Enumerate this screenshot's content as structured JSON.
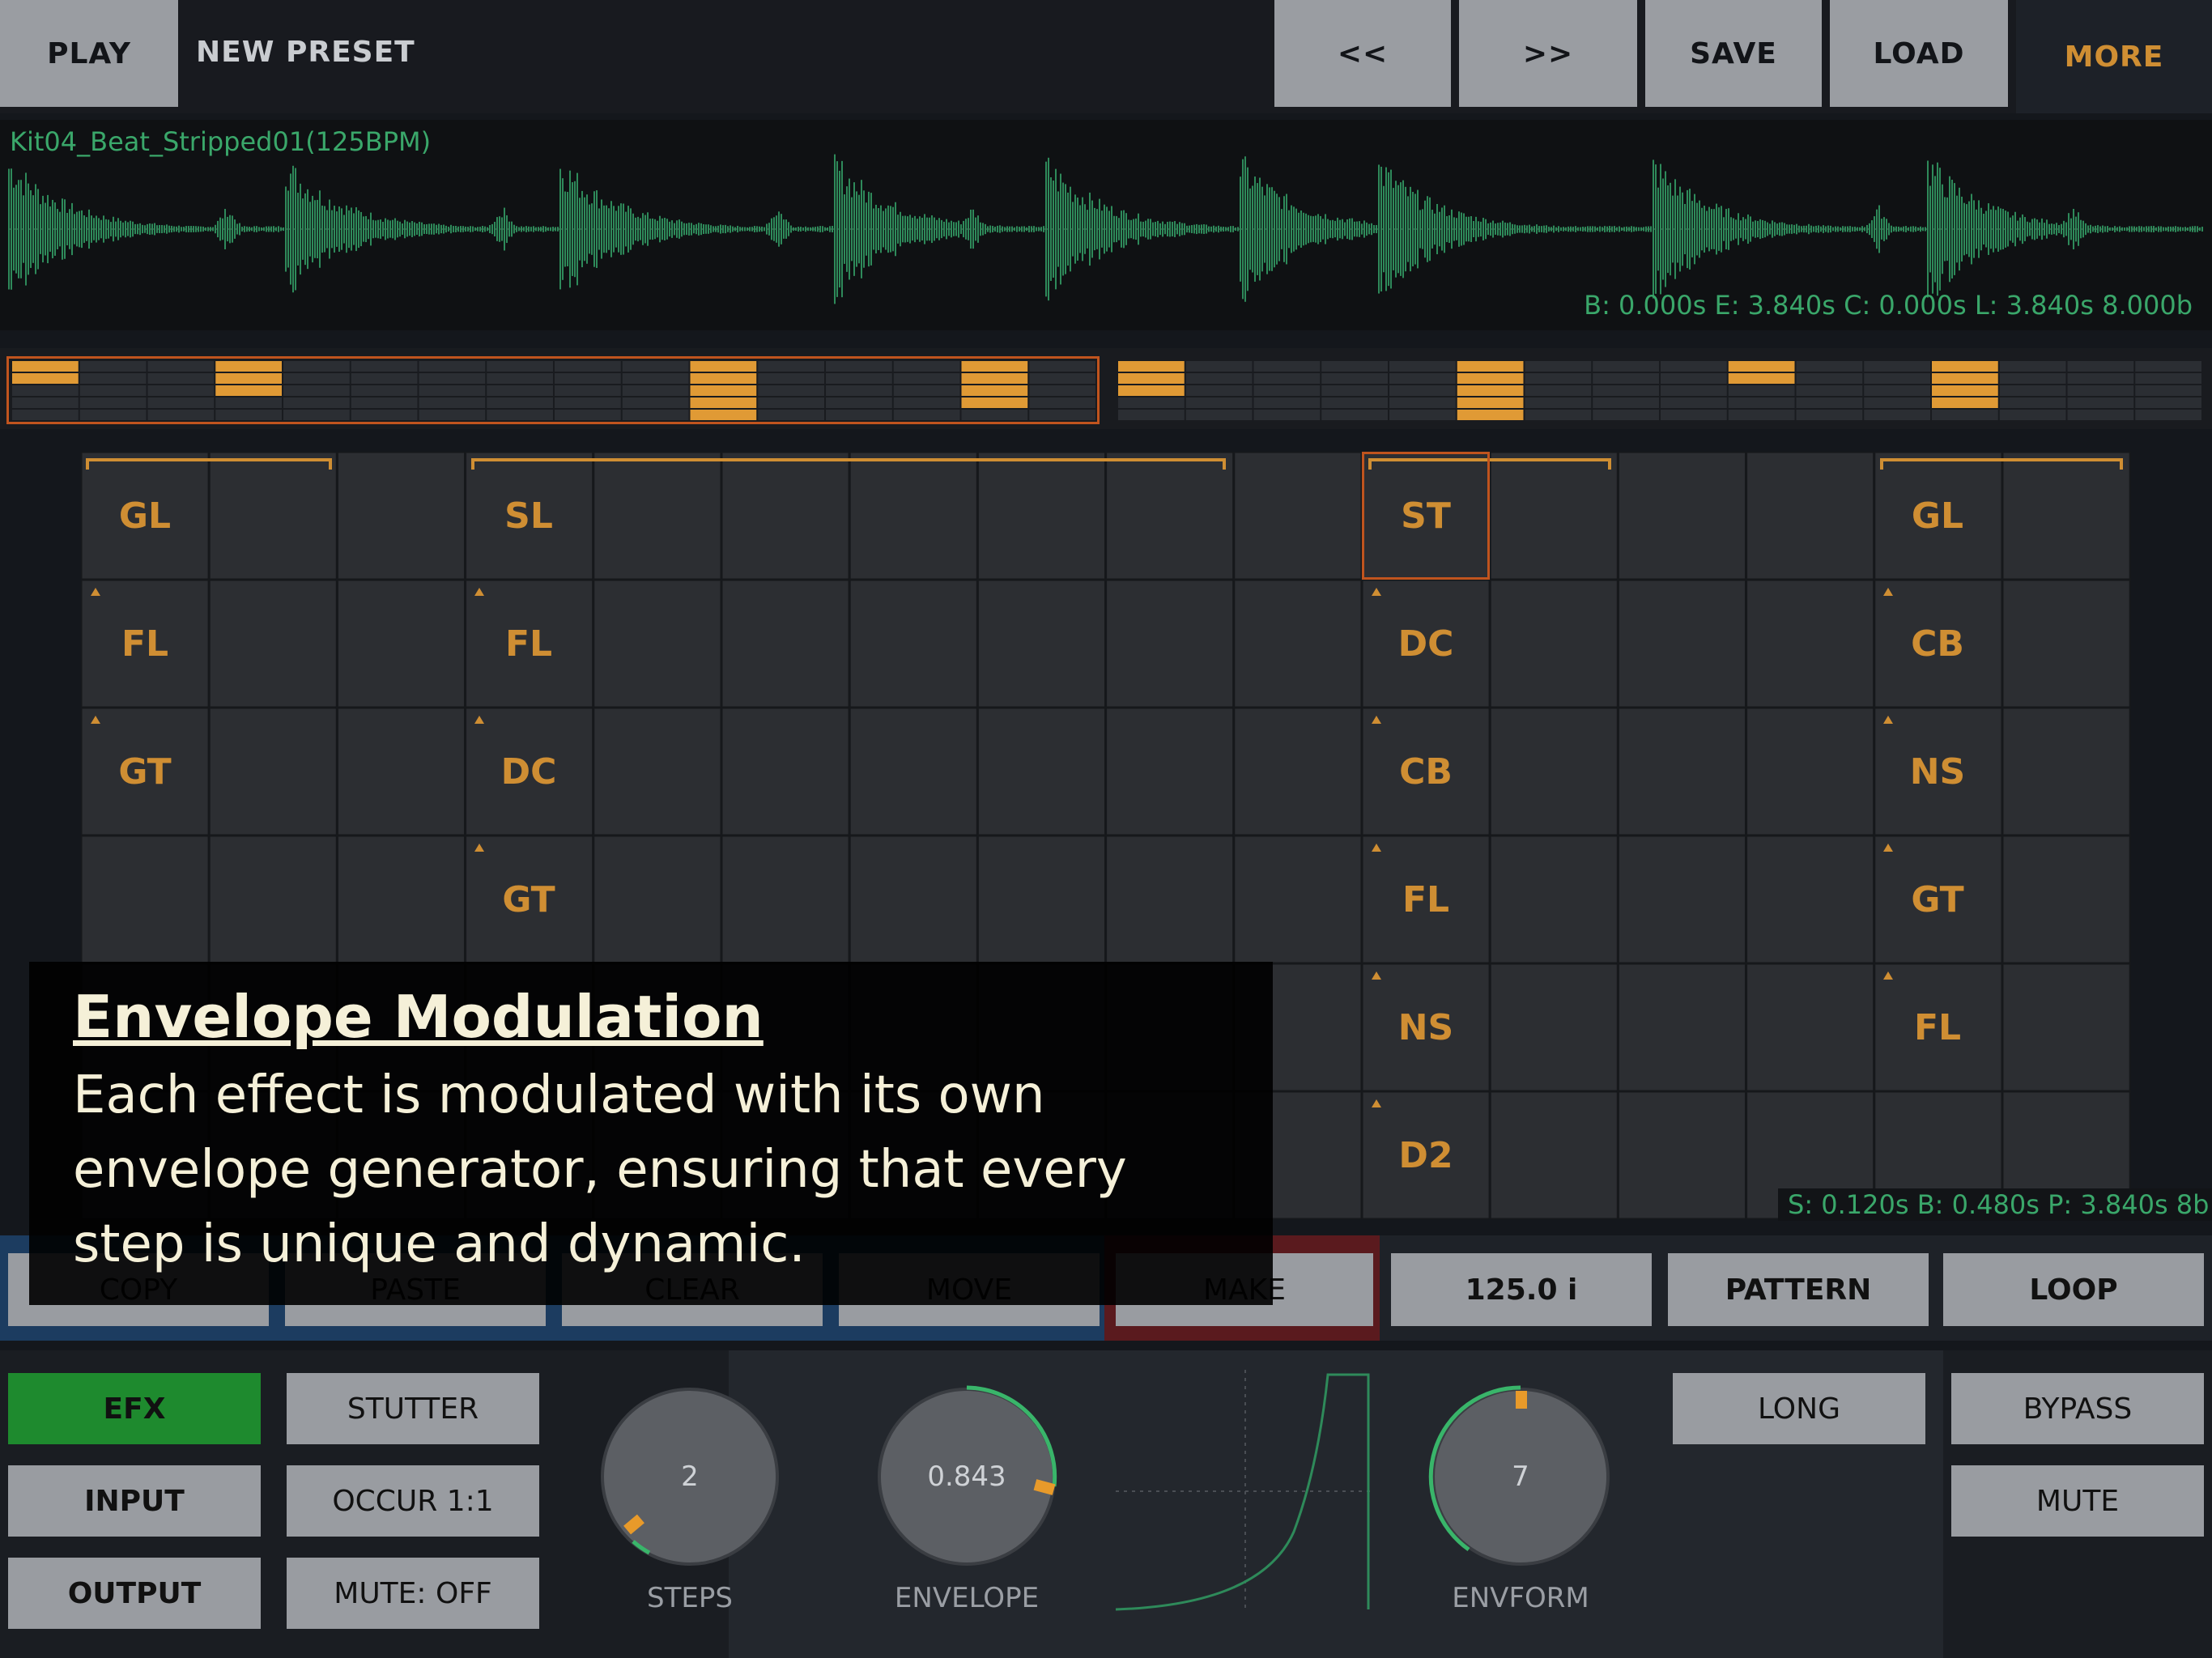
{
  "topbar": {
    "play": "PLAY",
    "preset_name": "NEW PRESET",
    "prev": "<<",
    "next": ">>",
    "save": "SAVE",
    "load": "LOAD",
    "more": "MORE"
  },
  "waveform": {
    "filename": "Kit04_Beat_Stripped01(125BPM)",
    "info": "B: 0.000s E: 3.840s C: 0.000s L: 3.840s 8.000b"
  },
  "grid": {
    "columns": [
      {
        "cells": [
          "GL",
          "FL",
          "GT",
          "",
          "",
          ""
        ]
      },
      {
        "cells": [
          "SL",
          "FL",
          "DC",
          "GT",
          "",
          ""
        ]
      },
      {
        "cells": [
          "ST",
          "DC",
          "CB",
          "FL",
          "NS",
          "D2"
        ]
      },
      {
        "cells": [
          "GL",
          "CB",
          "NS",
          "GT",
          "FL",
          ""
        ]
      }
    ],
    "timing": "S: 0.120s B: 0.480s P: 3.840s 8b"
  },
  "overlay": {
    "title": "Envelope Modulation",
    "body_line1": "Each effect is modulated with its own",
    "body_line2": "envelope generator, ensuring that every",
    "body_line3": "step is unique and dynamic."
  },
  "toolbar": {
    "copy": "COPY",
    "paste": "PASTE",
    "clear": "CLEAR",
    "move": "MOVE",
    "make": "MAKE",
    "tempo": "125.0 i",
    "pattern": "PATTERN",
    "loop": "LOOP"
  },
  "bottom": {
    "efx": "EFX",
    "input": "INPUT",
    "output": "OUTPUT",
    "stutter": "STUTTER",
    "occur": "OCCUR 1:1",
    "mute_state": "MUTE: OFF",
    "steps_label": "STEPS",
    "steps_value": "2",
    "envelope_label": "ENVELOPE",
    "envelope_value": "0.843",
    "envform_label": "ENVFORM",
    "envform_value": "7",
    "long": "LONG",
    "bypass": "BYPASS",
    "mute": "MUTE"
  },
  "colors": {
    "accent_orange": "#cf8e33",
    "wave_green": "#2e8a5a",
    "efx_green": "#1e8a2e"
  }
}
